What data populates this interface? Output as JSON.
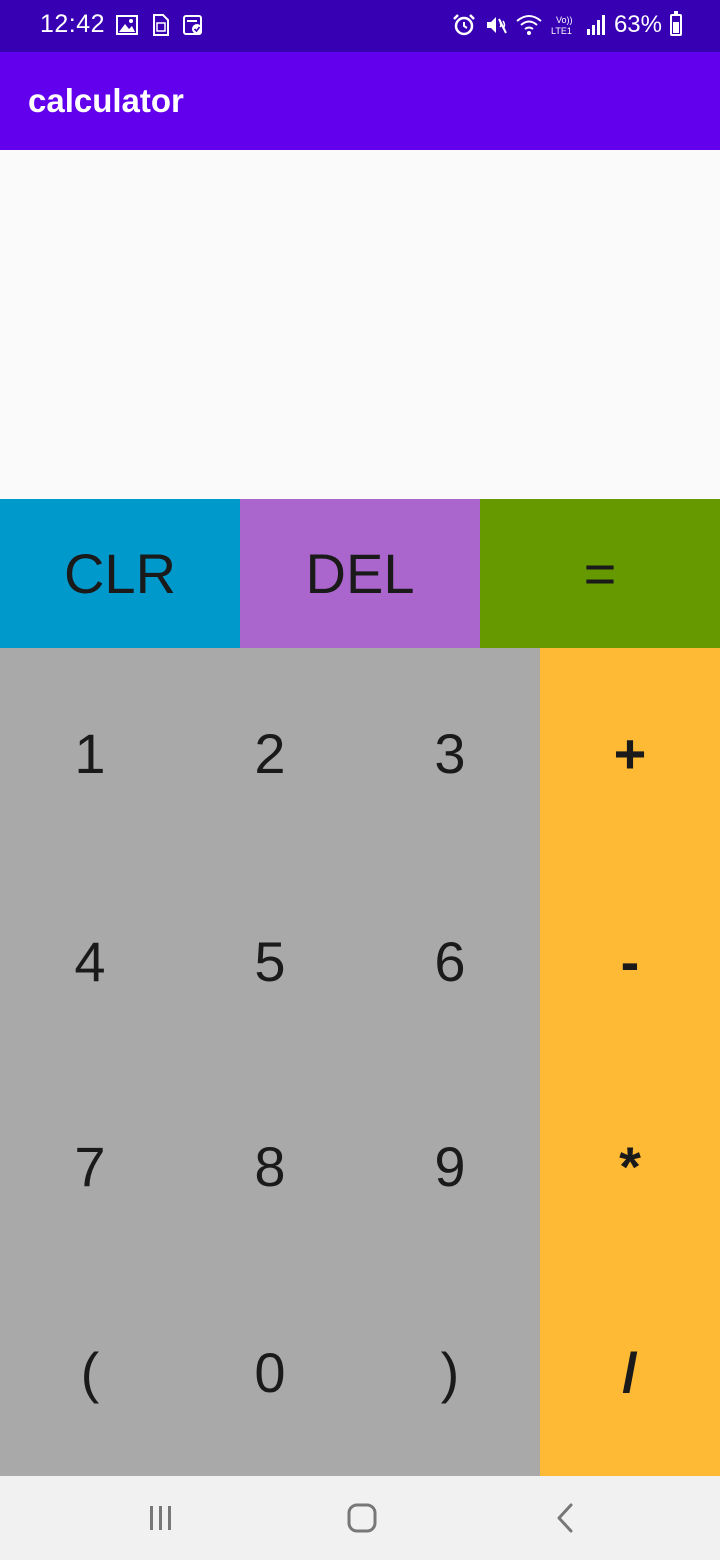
{
  "status_bar": {
    "time": "12:42",
    "battery": "63%",
    "icons": [
      "gallery-icon",
      "sim-toolkit-icon",
      "clipboard-check-icon",
      "alarm-icon",
      "mute-icon",
      "wifi-icon",
      "volte-icon",
      "signal-icon",
      "battery-icon"
    ],
    "background": "#3700b3"
  },
  "app_bar": {
    "title": "calculator",
    "background": "#6200ee"
  },
  "display": {
    "value": ""
  },
  "top_row": [
    {
      "label": "CLR",
      "color": "#0099cc"
    },
    {
      "label": "DEL",
      "color": "#aa66cc"
    },
    {
      "label": "=",
      "color": "#669900"
    }
  ],
  "keypad": [
    [
      "1",
      "2",
      "3",
      "+"
    ],
    [
      "4",
      "5",
      "6",
      "-"
    ],
    [
      "7",
      "8",
      "9",
      "*"
    ],
    [
      "(",
      "0",
      ")",
      "/"
    ]
  ],
  "colors": {
    "digit_key": "#a9a9a9",
    "operator_key": "#ffba35"
  },
  "nav_bar": {
    "icons": [
      "recent-apps-icon",
      "home-icon",
      "back-icon"
    ]
  }
}
